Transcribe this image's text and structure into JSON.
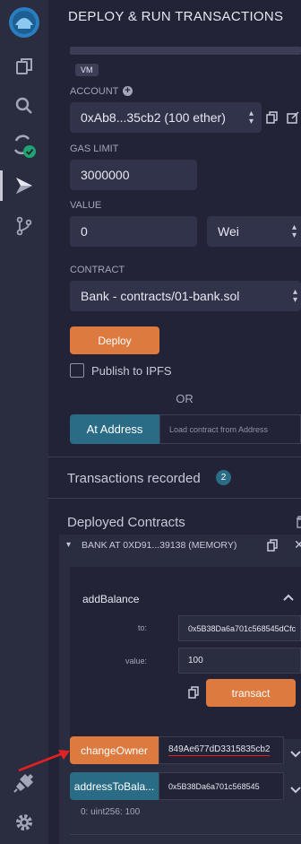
{
  "app": {
    "panel_title": "DEPLOY & RUN TRANSACTIONS",
    "environment_badge": "VM"
  },
  "account": {
    "label": "ACCOUNT",
    "value": "0xAb8...35cb2 (100 ether)"
  },
  "gas_limit": {
    "label": "GAS LIMIT",
    "value": "3000000"
  },
  "value": {
    "label": "VALUE",
    "amount": "0",
    "unit": "Wei"
  },
  "contract": {
    "label": "CONTRACT",
    "value": "Bank - contracts/01-bank.sol"
  },
  "deploy_label": "Deploy",
  "publish_label": "Publish to IPFS",
  "or_label": "OR",
  "at_address": {
    "button": "At Address",
    "placeholder": "Load contract from Address"
  },
  "transactions": {
    "title": "Transactions recorded",
    "count": "2"
  },
  "deployed": {
    "title": "Deployed Contracts",
    "instance_title": "BANK AT 0XD91...39138 (MEMORY)",
    "add_balance": {
      "name": "addBalance",
      "to_label": "to:",
      "to_value": "0x5B38Da6a701c568545dCfc",
      "value_label": "value:",
      "value_value": "100",
      "transact_label": "transact"
    },
    "change_owner": {
      "label": "changeOwner",
      "value": "849Ae677dD3315835cb2"
    },
    "address_to_balance": {
      "label": "addressToBala...",
      "value": "0x5B38Da6a701c568545"
    },
    "output": "0: uint256: 100"
  },
  "colors": {
    "accent_orange": "#dd7a3f",
    "accent_teal": "#2a6c85",
    "success_green": "#1ea672",
    "arrow_red": "#e02222"
  }
}
